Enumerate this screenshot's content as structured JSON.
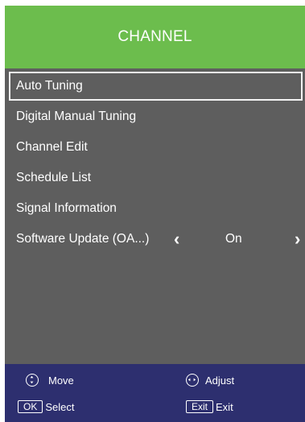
{
  "header": {
    "title": "CHANNEL"
  },
  "menu": {
    "items": [
      {
        "label": "Auto Tuning",
        "selected": true
      },
      {
        "label": "Digital Manual Tuning"
      },
      {
        "label": "Channel Edit"
      },
      {
        "label": "Schedule List"
      },
      {
        "label": "Signal Information"
      },
      {
        "label": "Software Update (OA...)",
        "value": "On"
      }
    ]
  },
  "footer": {
    "move_label": "Move",
    "adjust_label": "Adjust",
    "ok_key": "OK",
    "select_label": "Select",
    "exit_key": "Exit",
    "exit_label": "Exit"
  },
  "colors": {
    "header_bg": "#6cbd4d",
    "panel_bg": "#5e5e5e",
    "footer_bg": "#2d2f6f",
    "text": "#ffffff"
  },
  "icons": {
    "move": "up-down-circle-icon",
    "adjust": "left-right-circle-icon"
  }
}
